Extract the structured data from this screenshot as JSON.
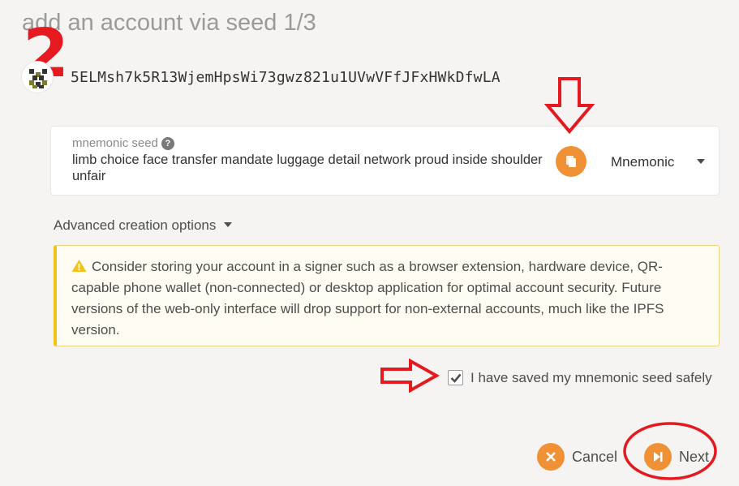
{
  "modal": {
    "title": "add an account via seed 1/3",
    "step_annotation": "2"
  },
  "account": {
    "address": "5ELMsh7k5R13WjemHpsWi73gwz821u1UVwVFfJFxHWkDfwLA",
    "icon": "identicon"
  },
  "seed": {
    "label": "mnemonic seed",
    "help_icon": "?",
    "value": "limb choice face transfer mandate luggage detail network proud inside shoulder unfair",
    "copy_icon": "copy-icon",
    "type_selected": "Mnemonic"
  },
  "advanced": {
    "label": "Advanced creation options"
  },
  "warning": {
    "icon": "warning-triangle-icon",
    "text": "Consider storing your account in a signer such as a browser extension, hardware device, QR-capable phone wallet (non-connected) or desktop application for optimal account security. Future versions of the web-only interface will drop support for non-external accounts, much like the IPFS version."
  },
  "confirmation": {
    "label": "I have saved my mnemonic seed safely",
    "checked": true
  },
  "actions": {
    "cancel_label": "Cancel",
    "next_label": "Next"
  },
  "colors": {
    "accent": "#f19135",
    "annotation_red": "#e51a21",
    "warning_border": "#f3c21b",
    "background": "#f5f4f3"
  }
}
